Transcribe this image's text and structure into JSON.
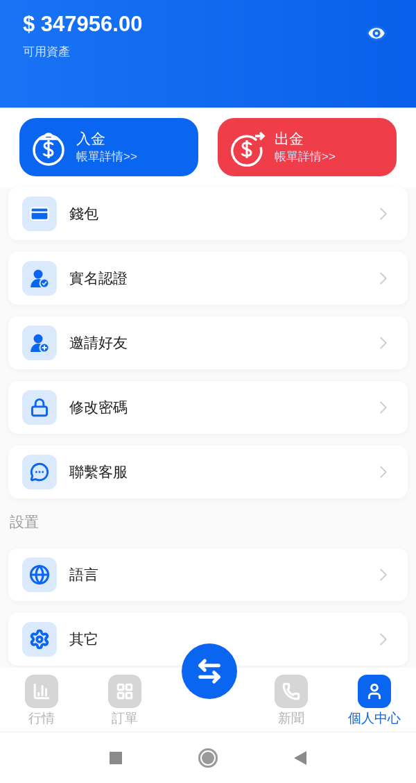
{
  "balance": {
    "amount": "$ 347956.00",
    "label": "可用資產"
  },
  "actions": [
    {
      "kind": "deposit",
      "title": "入金",
      "subtitle": "帳單詳情>>"
    },
    {
      "kind": "withdraw",
      "title": "出金",
      "subtitle": "帳單詳情>>"
    }
  ],
  "menu": [
    {
      "label": "錢包"
    },
    {
      "label": "實名認證"
    },
    {
      "label": "邀請好友"
    },
    {
      "label": "修改密碼"
    },
    {
      "label": "聯繫客服"
    }
  ],
  "settings": {
    "title": "設置",
    "items": [
      {
        "label": "語言"
      },
      {
        "label": "其它"
      }
    ]
  },
  "tabbar": [
    {
      "label": "行情",
      "selected": false
    },
    {
      "label": "訂單",
      "selected": false
    },
    {
      "label": "新聞",
      "selected": false
    },
    {
      "label": "個人中心",
      "selected": true
    }
  ]
}
